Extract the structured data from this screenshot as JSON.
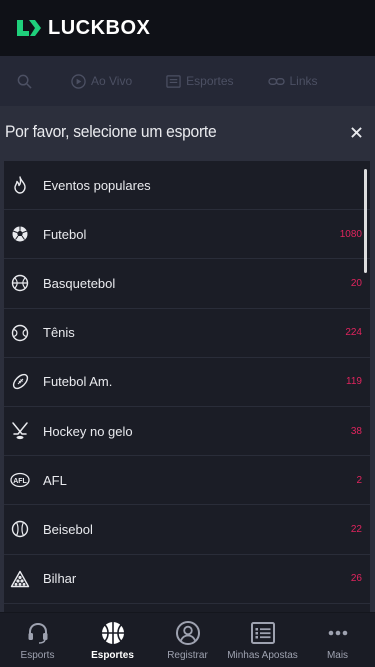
{
  "header": {
    "brand": "LUCKBOX",
    "logo_icon": "luckbox-logo-icon"
  },
  "subnav": {
    "items": [
      {
        "label": "",
        "icon": "search-icon"
      },
      {
        "label": "Ao Vivo",
        "icon": "play-icon"
      },
      {
        "label": "Esportes",
        "icon": "list-icon"
      },
      {
        "label": "Links",
        "icon": "link-icon"
      }
    ]
  },
  "modal": {
    "title": "Por favor, selecione um esporte",
    "close_icon": "close-icon",
    "sports": [
      {
        "name": "Eventos populares",
        "count": "",
        "icon": "flame-icon"
      },
      {
        "name": "Futebol",
        "count": "1080",
        "icon": "soccer-ball-icon"
      },
      {
        "name": "Basquetebol",
        "count": "20",
        "icon": "basketball-icon"
      },
      {
        "name": "Tênis",
        "count": "224",
        "icon": "tennis-ball-icon"
      },
      {
        "name": "Futebol Am.",
        "count": "119",
        "icon": "american-football-icon"
      },
      {
        "name": "Hockey no gelo",
        "count": "38",
        "icon": "hockey-icon"
      },
      {
        "name": "AFL",
        "count": "2",
        "icon": "afl-icon"
      },
      {
        "name": "Beisebol",
        "count": "22",
        "icon": "baseball-icon"
      },
      {
        "name": "Bilhar",
        "count": "26",
        "icon": "billiards-icon"
      }
    ]
  },
  "bottom_nav": {
    "items": [
      {
        "label": "Esports",
        "icon": "headset-icon",
        "active": false
      },
      {
        "label": "Esportes",
        "icon": "basketball-icon",
        "active": true
      },
      {
        "label": "Registrar",
        "icon": "user-icon",
        "active": false
      },
      {
        "label": "Minhas Apostas",
        "icon": "betslip-icon",
        "active": false
      },
      {
        "label": "Mais",
        "icon": "more-dots-icon",
        "active": false
      }
    ]
  },
  "colors": {
    "accent": "#1fcf7b",
    "count": "#e0245e",
    "background": "#1b1d26",
    "modal_bg": "#2c2f3c"
  }
}
